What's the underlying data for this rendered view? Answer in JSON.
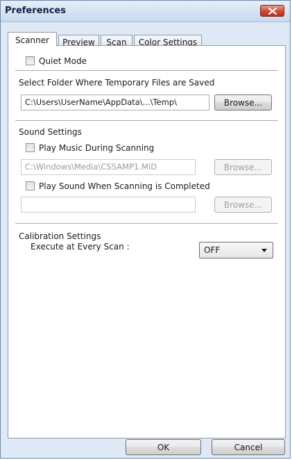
{
  "window": {
    "title": "Preferences"
  },
  "tabs": [
    {
      "label": "Scanner",
      "active": true
    },
    {
      "label": "Preview",
      "active": false
    },
    {
      "label": "Scan",
      "active": false
    },
    {
      "label": "Color Settings",
      "active": false
    }
  ],
  "scanner": {
    "quiet_mode_label": "Quiet Mode",
    "quiet_mode_checked": false,
    "temp_folder_heading": "Select Folder Where Temporary Files are Saved",
    "temp_folder_path": "C:\\Users\\UserName\\AppData\\...\\Temp\\",
    "temp_browse_label": "Browse...",
    "sound_heading": "Sound Settings",
    "play_music_label": "Play Music During Scanning",
    "play_music_checked": false,
    "music_path": "C:\\Windows\\Media\\CSSAMP1.MID",
    "music_browse_label": "Browse...",
    "play_sound_label": "Play Sound When Scanning is Completed",
    "play_sound_checked": false,
    "sound_path": "",
    "sound_browse_label": "Browse...",
    "calibration_heading": "Calibration Settings",
    "execute_label": "Execute at Every Scan :",
    "execute_value": "OFF"
  },
  "footer": {
    "ok_label": "OK",
    "cancel_label": "Cancel"
  },
  "colors": {
    "window_bg": "#dfe9f5",
    "close_button": "#cf4a36"
  }
}
